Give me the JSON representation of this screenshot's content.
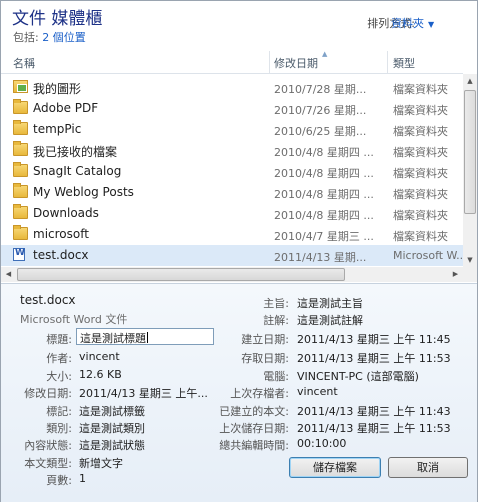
{
  "header": {
    "title": "文件 媒體櫃",
    "includes_label": "包括:",
    "includes_link": "2 個位置",
    "arrange_label": "排列方式:",
    "arrange_value": "資料夾"
  },
  "columns": {
    "name": "名稱",
    "date": "修改日期",
    "type": "類型"
  },
  "files": [
    {
      "name": "我的圖形",
      "date": "2010/7/28 星期...",
      "type": "檔案資料夾",
      "icon": "pictures-folder-icon"
    },
    {
      "name": "Adobe PDF",
      "date": "2010/7/26 星期...",
      "type": "檔案資料夾",
      "icon": "folder-icon"
    },
    {
      "name": "tempPic",
      "date": "2010/6/25 星期...",
      "type": "檔案資料夾",
      "icon": "folder-icon"
    },
    {
      "name": "我已接收的檔案",
      "date": "2010/4/8 星期四 ...",
      "type": "檔案資料夾",
      "icon": "folder-icon"
    },
    {
      "name": "SnagIt Catalog",
      "date": "2010/4/8 星期四 ...",
      "type": "檔案資料夾",
      "icon": "folder-icon"
    },
    {
      "name": "My Weblog Posts",
      "date": "2010/4/8 星期四 ...",
      "type": "檔案資料夾",
      "icon": "folder-icon"
    },
    {
      "name": "Downloads",
      "date": "2010/4/8 星期四 ...",
      "type": "檔案資料夾",
      "icon": "folder-icon"
    },
    {
      "name": "microsoft",
      "date": "2010/4/7 星期三 ...",
      "type": "檔案資料夾",
      "icon": "folder-icon"
    },
    {
      "name": "test.docx",
      "date": "2011/4/13 星期...",
      "type": "Microsoft W...",
      "icon": "word-document-icon"
    }
  ],
  "details": {
    "file_name": "test.docx",
    "file_type": "Microsoft Word 文件",
    "left": [
      {
        "label": "標題:",
        "value": "這是測試標題"
      },
      {
        "label": "作者:",
        "value": "vincent"
      },
      {
        "label": "大小:",
        "value": "12.6 KB"
      },
      {
        "label": "修改日期:",
        "value": "2011/4/13 星期三 上午..."
      },
      {
        "label": "標記:",
        "value": "這是測試標籤"
      },
      {
        "label": "類別:",
        "value": "這是測試類別"
      },
      {
        "label": "內容狀態:",
        "value": "這是測試狀態"
      },
      {
        "label": "本文類型:",
        "value": "新增文字"
      },
      {
        "label": "頁數:",
        "value": "1"
      }
    ],
    "right": [
      {
        "label": "主旨:",
        "value": "這是測試主旨"
      },
      {
        "label": "註解:",
        "value": "這是測試註解"
      },
      {
        "label": "建立日期:",
        "value": "2011/4/13 星期三 上午 11:45"
      },
      {
        "label": "存取日期:",
        "value": "2011/4/13 星期三 上午 11:53"
      },
      {
        "label": "電腦:",
        "value": "VINCENT-PC (這部電腦)"
      },
      {
        "label": "上次存檔者:",
        "value": "vincent"
      },
      {
        "label": "已建立的本文:",
        "value": "2011/4/13 星期三 上午 11:43"
      },
      {
        "label": "上次儲存日期:",
        "value": "2011/4/13 星期三 上午 11:53"
      },
      {
        "label": "總共編輯時間:",
        "value": "00:10:00"
      }
    ],
    "save_label": "儲存檔案",
    "cancel_label": "取消"
  },
  "colors": {
    "accent": "#1a5fc8",
    "title": "#1e3287",
    "selected_row": "#dbe9f8"
  }
}
